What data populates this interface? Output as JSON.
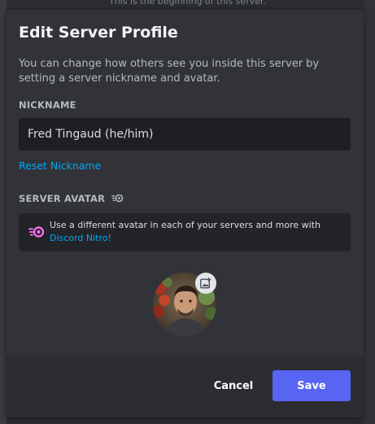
{
  "background": {
    "top_text": "This is the beginning of this server."
  },
  "modal": {
    "title": "Edit Server Profile",
    "description": "You can change how others see you inside this server by setting a server nickname and avatar.",
    "nickname": {
      "label": "NICKNAME",
      "value": "Fred Tingaud (he/him)",
      "reset_label": "Reset Nickname"
    },
    "server_avatar": {
      "label": "SERVER AVATAR",
      "nitro_text": "Use a different avatar in each of your servers and more with ",
      "nitro_link": "Discord Nitro!"
    },
    "footer": {
      "cancel_label": "Cancel",
      "save_label": "Save"
    }
  },
  "colors": {
    "accent": "#5865f2",
    "link": "#00a8fc",
    "nitro_pink": "#ff73fa"
  },
  "icons": {
    "nitro": "nitro-icon",
    "add_image": "add-image-icon"
  }
}
